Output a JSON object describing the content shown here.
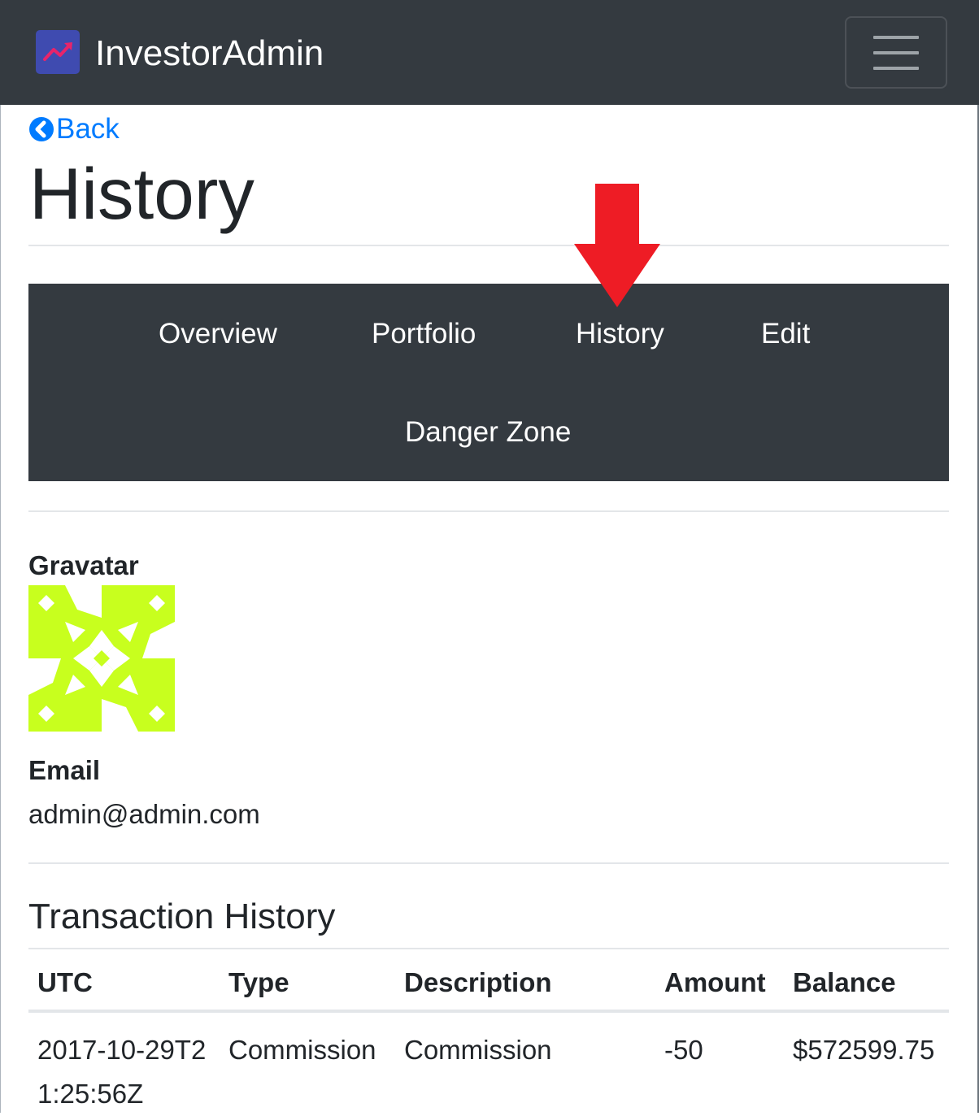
{
  "navbar": {
    "brand": "InvestorAdmin",
    "logo_icon": "trending-up-icon",
    "toggler_icon": "hamburger-icon"
  },
  "back": {
    "label": "Back",
    "icon": "chevron-left-circle-icon"
  },
  "page": {
    "title": "History"
  },
  "tabs": [
    {
      "label": "Overview"
    },
    {
      "label": "Portfolio"
    },
    {
      "label": "History",
      "active": true
    },
    {
      "label": "Edit"
    },
    {
      "label": "Danger Zone"
    }
  ],
  "annotation": {
    "icon": "red-down-arrow-icon",
    "color": "#ee1c25"
  },
  "profile": {
    "gravatar_label": "Gravatar",
    "gravatar_color": "#c8ff1e",
    "email_label": "Email",
    "email": "admin@admin.com"
  },
  "transactions": {
    "title": "Transaction History",
    "headers": [
      "UTC",
      "Type",
      "Description",
      "Amount",
      "Balance"
    ],
    "rows": [
      {
        "utc": "2017-10-29T21:25:56Z",
        "type": "Commission",
        "description": "Commission",
        "amount": "-50",
        "balance": "$572599.75"
      }
    ]
  },
  "colors": {
    "navbar_bg": "#343a40",
    "link": "#007bff",
    "text": "#212529"
  }
}
